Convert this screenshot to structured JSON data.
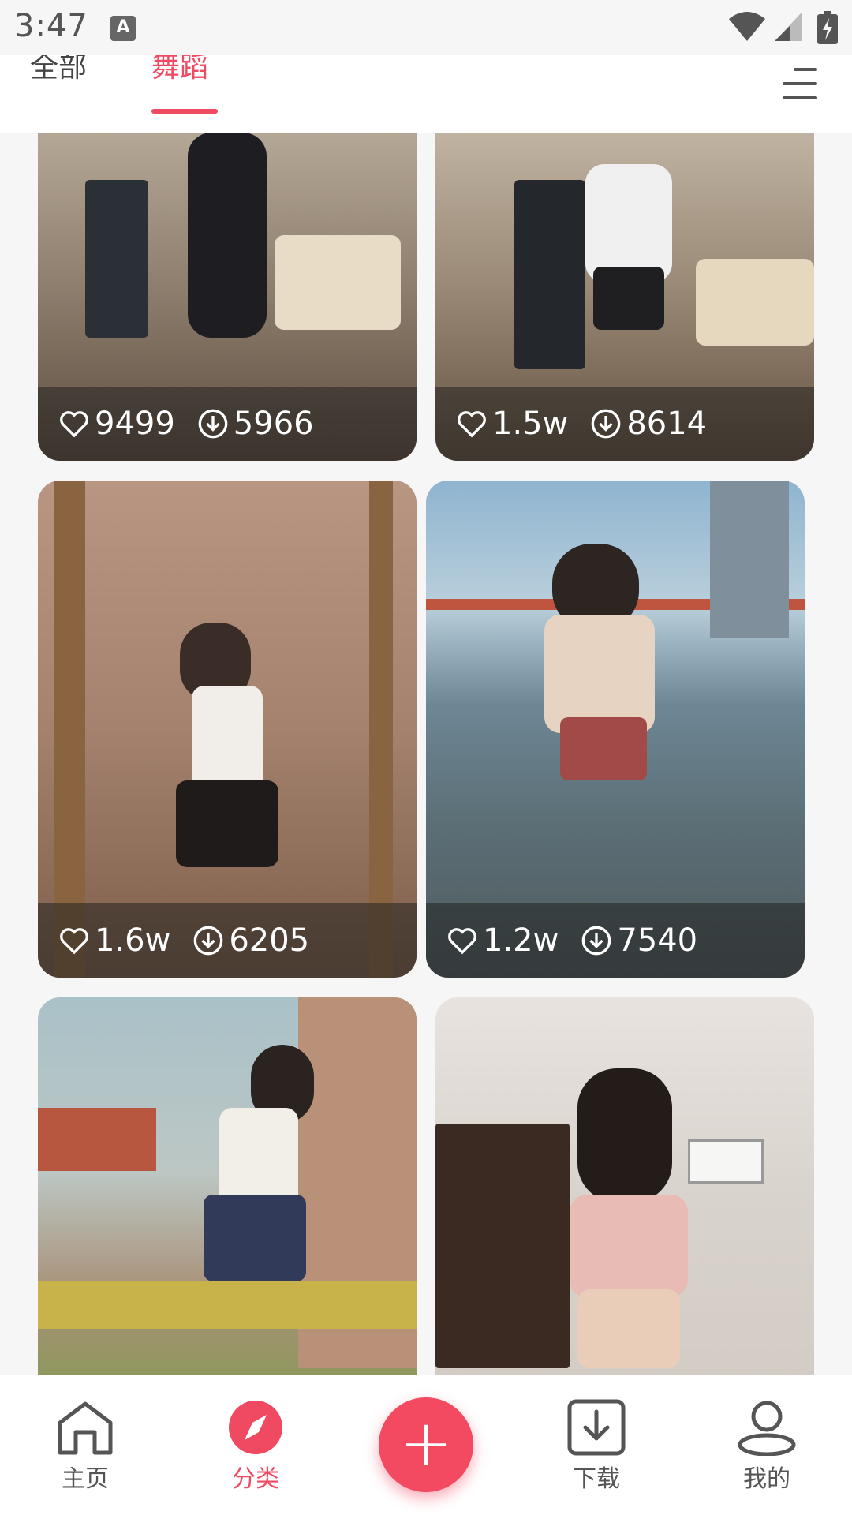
{
  "status_bar": {
    "time": "3:47",
    "notification_icon_letter": "A"
  },
  "tabs": [
    {
      "label": "全部",
      "active": false
    },
    {
      "label": "舞蹈",
      "active": true
    }
  ],
  "cards": [
    {
      "likes": "9499",
      "downloads": "5966"
    },
    {
      "likes": "1.5w",
      "downloads": "8614"
    },
    {
      "likes": "1.6w",
      "downloads": "6205"
    },
    {
      "likes": "1.2w",
      "downloads": "7540"
    },
    {
      "likes": "",
      "downloads": ""
    },
    {
      "likes": "",
      "downloads": ""
    }
  ],
  "bottom_nav": {
    "home_label": "主页",
    "category_label": "分类",
    "download_label": "下载",
    "mine_label": "我的",
    "active": "分类"
  },
  "colors": {
    "accent": "#f04a63",
    "fab": "#f34a62",
    "text_gray": "#555555",
    "background": "#f6f6f6"
  }
}
